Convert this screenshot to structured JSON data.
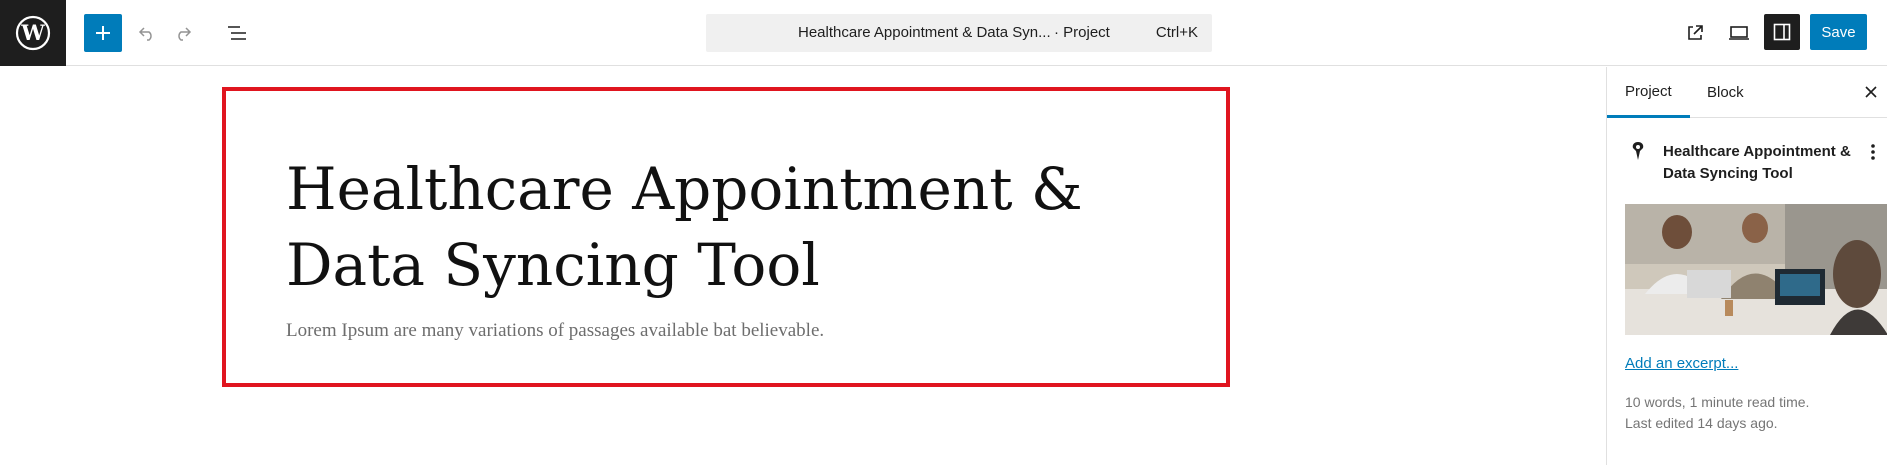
{
  "toolbar": {
    "add_block_label": "+",
    "command_bar": {
      "title": "Healthcare Appointment & Data Syn...",
      "type": "· Project",
      "shortcut": "Ctrl+K"
    },
    "save_label": "Save",
    "icons": {
      "logo": "wordpress-logo",
      "add": "plus-icon",
      "undo": "undo-icon",
      "redo": "redo-icon",
      "list_view": "list-view-icon",
      "view_post": "external-link-icon",
      "preview": "desktop-preview-icon",
      "settings": "sidebar-toggle-icon"
    }
  },
  "canvas": {
    "title": "Healthcare Appointment & Data Syncing Tool",
    "excerpt": "Lorem Ipsum are many variations of passages available bat believable."
  },
  "sidebar": {
    "tabs": [
      {
        "label": "Project",
        "active": true
      },
      {
        "label": "Block",
        "active": false
      }
    ],
    "post_card": {
      "title": "Healthcare Appointment & Data Syncing Tool",
      "icon": "pin-icon"
    },
    "add_excerpt": "Add an excerpt...",
    "meta_words": "10 words, 1 minute read time.",
    "meta_edited": "Last edited 14 days ago."
  },
  "colors": {
    "accent": "#007cba",
    "dark": "#1e1e1e",
    "selection": "#e0151f",
    "muted": "#757575"
  }
}
